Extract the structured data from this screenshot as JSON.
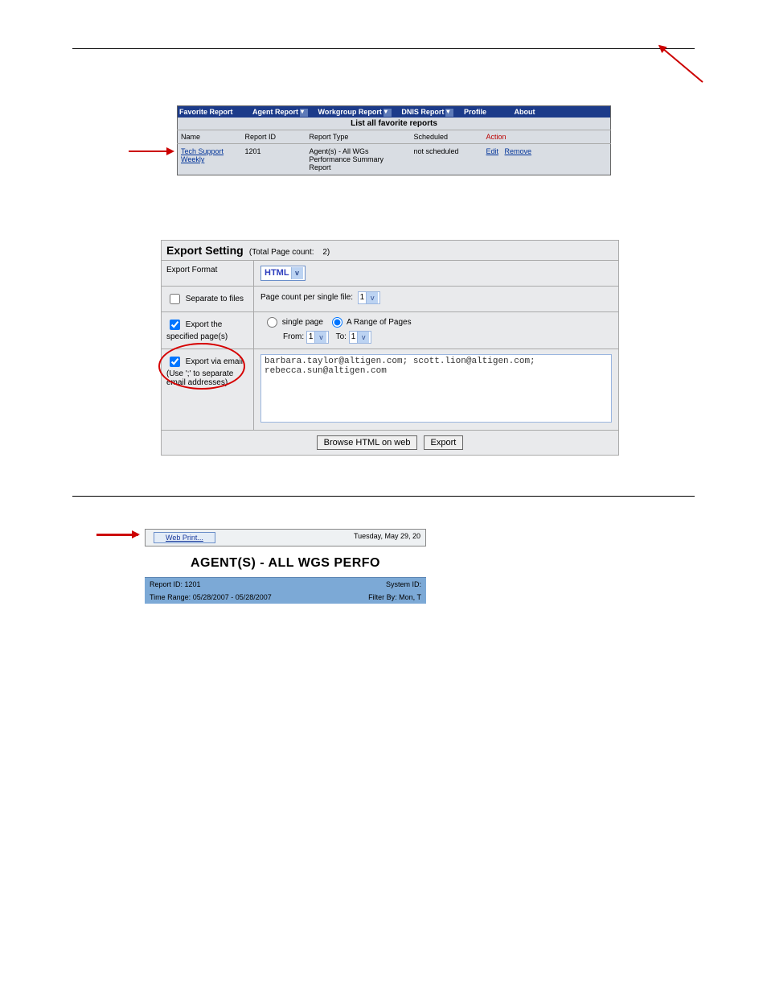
{
  "fav": {
    "menu": {
      "favorite": "Favorite Report",
      "agent": "Agent Report",
      "workgroup": "Workgroup Report",
      "dnis": "DNIS Report",
      "profile": "Profile",
      "about": "About"
    },
    "title": "List all favorite reports",
    "headers": {
      "name": "Name",
      "report_id": "Report ID",
      "report_type": "Report Type",
      "scheduled": "Scheduled",
      "action": "Action"
    },
    "row": {
      "name": "Tech Support Weekly",
      "report_id": "1201",
      "report_type": "Agent(s) - All WGs Performance Summary Report",
      "scheduled": "not scheduled",
      "action_edit": "Edit",
      "action_remove": "Remove"
    }
  },
  "export": {
    "title_bold": "Export Setting",
    "title_count_label": "(Total Page count:",
    "title_count_value": "2)",
    "row_format_label": "Export Format",
    "format_value": "HTML",
    "separate_label": "Separate to files",
    "page_count_label": "Page count per single file:",
    "page_count_value": "1",
    "specified_label": "Export the specified page(s)",
    "single_page": "single page",
    "range_label": "A Range of Pages",
    "from_label": "From:",
    "from_value": "1",
    "to_label": "To:",
    "to_value": "1",
    "email_label_line1": "Export via email",
    "email_label_line2": "(Use ';' to separate email addresses)",
    "email_text": "barbara.taylor@altigen.com; scott.lion@altigen.com; rebecca.sun@altigen.com",
    "browse_btn": "Browse HTML on web",
    "export_btn": "Export"
  },
  "webprint": {
    "button": "Web Print...",
    "date": "Tuesday, May 29, 20",
    "title": "AGENT(S) - ALL WGS PERFO",
    "report_id": "Report ID: 1201",
    "system_id": "System ID:",
    "time_range": "Time Range: 05/28/2007 - 05/28/2007",
    "filter_by": "Filter By: Mon, T"
  }
}
